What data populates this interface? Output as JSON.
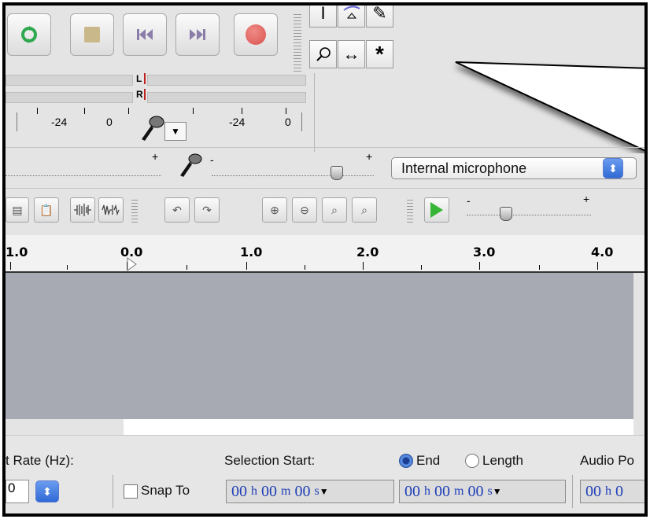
{
  "devices": {
    "input_device": "Internal microphone"
  },
  "meters": {
    "left_channel": "L",
    "right_channel": "R",
    "scale_left_1": "-24",
    "scale_left_2": "0",
    "scale_right_1": "-24",
    "scale_right_2": "0"
  },
  "mixer": {
    "plus_1": "+",
    "plus_2": "+",
    "minus": "-"
  },
  "speed": {
    "minus": "-",
    "plus": "+"
  },
  "ruler": {
    "labels": [
      "1.0",
      "0.0",
      "1.0",
      "2.0",
      "3.0",
      "4.0"
    ]
  },
  "bottom": {
    "rate_label": "t Rate (Hz):",
    "rate_value": "0",
    "snap_to": "Snap To",
    "selection_start": "Selection Start:",
    "end": "End",
    "length": "Length",
    "audio_position": "Audio Po",
    "start_time": {
      "h": "00",
      "m": "00",
      "s": "00"
    },
    "end_time": {
      "h": "00",
      "m": "00",
      "s": "00"
    },
    "audio_time": {
      "h": "00",
      "m": "0"
    },
    "unit_h": "h",
    "unit_m": "m",
    "unit_s": "s"
  },
  "colors": {
    "play_green": "#37b537",
    "record_red": "#d9534f",
    "loop_green": "#2fa84f",
    "track_gray": "#a7a9b3",
    "time_blue": "#1f3fb8"
  }
}
